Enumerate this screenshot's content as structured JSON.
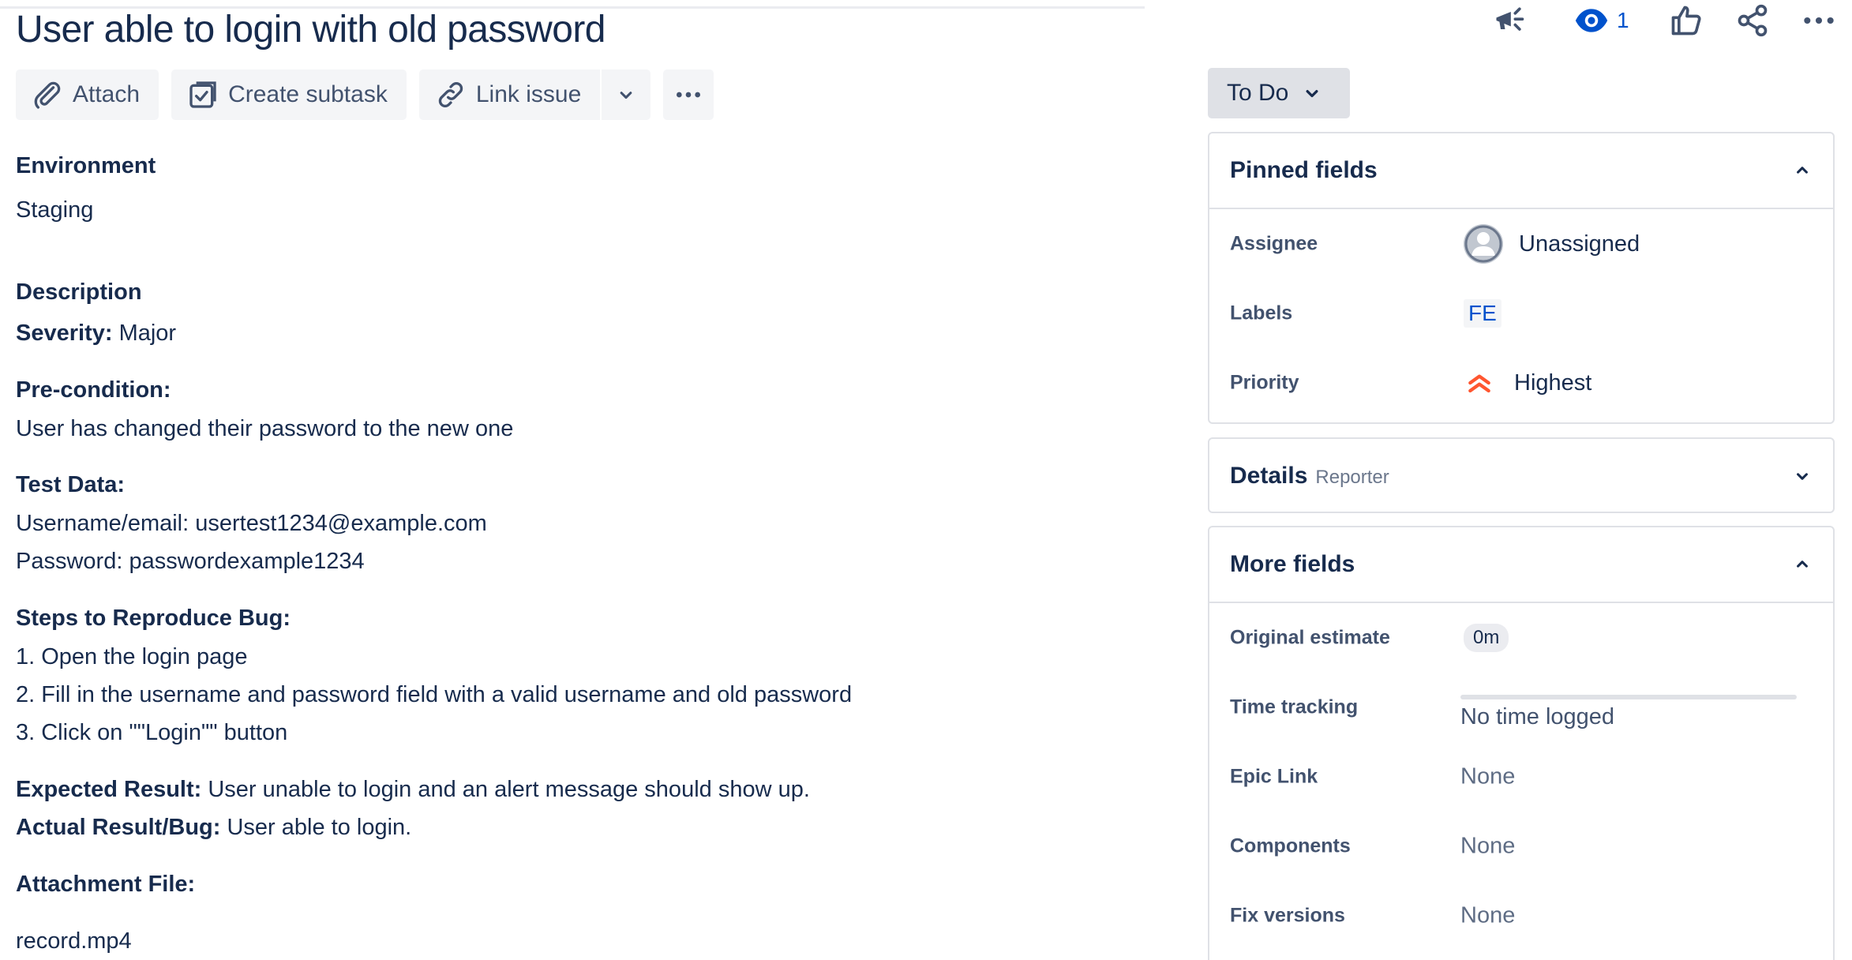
{
  "issue": {
    "title": "User able to login with old password"
  },
  "toolbar": {
    "attach": "Attach",
    "create_subtask": "Create subtask",
    "link_issue": "Link issue"
  },
  "header_actions": {
    "watch_count": "1"
  },
  "content": {
    "environment_heading": "Environment",
    "environment_value": "Staging",
    "description_heading": "Description",
    "severity_label": "Severity:",
    "severity_value": " Major",
    "precondition_label": "Pre-condition:",
    "precondition_value": "User has changed their password to the new one",
    "testdata_label": "Test Data:",
    "testdata_line1": "Username/email: usertest1234@example.com",
    "testdata_line2": "Password: passwordexample1234",
    "steps_label": "Steps to Reproduce Bug:",
    "step1": "1. Open the login page",
    "step2": "2. Fill in the username and password field with a valid username and old password",
    "step3": "3. Click on \"\"Login\"\" button",
    "expected_label": "Expected Result:",
    "expected_value": " User unable to login and an alert message should show up.",
    "actual_label": "Actual Result/Bug:",
    "actual_value": " User able to login.",
    "attachment_label": "Attachment File:",
    "attachment_value": "record.mp4"
  },
  "status": {
    "label": "To Do"
  },
  "pinned": {
    "title": "Pinned fields",
    "assignee_label": "Assignee",
    "assignee_value": "Unassigned",
    "labels_label": "Labels",
    "labels_value": "FE",
    "priority_label": "Priority",
    "priority_value": "Highest",
    "priority_color": "#ff5630"
  },
  "details": {
    "title": "Details",
    "subtitle": "Reporter"
  },
  "more_fields": {
    "title": "More fields",
    "original_estimate_label": "Original estimate",
    "original_estimate_value": "0m",
    "time_tracking_label": "Time tracking",
    "time_tracking_value": "No time logged",
    "epic_link_label": "Epic Link",
    "epic_link_value": "None",
    "components_label": "Components",
    "components_value": "None",
    "fix_versions_label": "Fix versions",
    "fix_versions_value": "None"
  },
  "colors": {
    "text": "#172b4d",
    "link_blue": "#0052cc",
    "button_bg": "#f4f5f7",
    "status_bg": "#dfe1e6"
  }
}
